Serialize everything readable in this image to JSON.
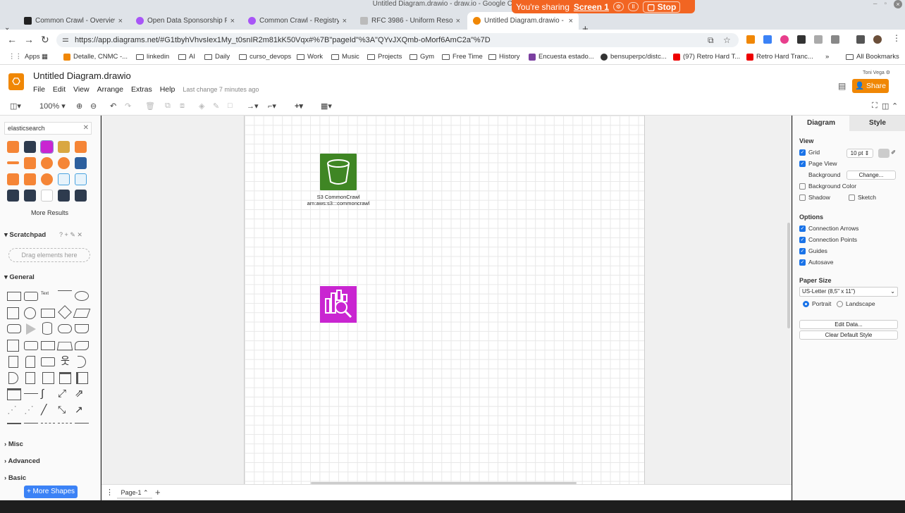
{
  "window": {
    "title": "Untitled Diagram.drawio - draw.io - Google Chrome"
  },
  "share_banner": {
    "text": "You're sharing",
    "screen": "Screen 1",
    "stop": "Stop"
  },
  "tabs": [
    {
      "label": "Common Crawl - Overview",
      "color": "#222222"
    },
    {
      "label": "Open Data Sponsorship Prog...",
      "color": "#a855f7"
    },
    {
      "label": "Common Crawl - Registry of...",
      "color": "#a855f7"
    },
    {
      "label": "RFC 3986 - Uniform Resourc...",
      "color": "#bbbbbb"
    },
    {
      "label": "Untitled Diagram.drawio - d...",
      "color": "#f08705"
    }
  ],
  "address": {
    "url": "https://app.diagrams.net/#G1tbyhVhvsIex1My_t0snIR2m81kK50Vqx#%7B\"pageId\"%3A\"QYvJXQmb-oMorf6AmC2a\"%7D"
  },
  "bookmarks": [
    "Apps",
    "Detalle, CNMC -...",
    "linkedin",
    "AI",
    "Daily",
    "curso_devops",
    "Work",
    "Music",
    "Projects",
    "Gym",
    "Free Time",
    "History",
    "Encuesta estado...",
    "bensuperpc/distc...",
    "(97) Retro Hard T...",
    "Retro Hard Tranc...",
    "All Bookmarks"
  ],
  "drawio": {
    "title": "Untitled Diagram.drawio",
    "menu": [
      "File",
      "Edit",
      "View",
      "Arrange",
      "Extras",
      "Help"
    ],
    "last_change": "Last change 7 minutes ago",
    "user": "Toni Vega",
    "share": "Share",
    "zoom": "100%"
  },
  "left": {
    "search_value": "elasticsearch",
    "more_results": "More Results",
    "scratchpad": "Scratchpad",
    "drag_here": "Drag elements here",
    "general": "General",
    "misc": "Misc",
    "advanced": "Advanced",
    "basic": "Basic",
    "more_shapes": "+ More Shapes"
  },
  "canvas": {
    "s3_name": "S3 CommonCrawl",
    "s3_arn": "arn:aws:s3:::commoncrawl",
    "page_tab": "Page-1"
  },
  "right": {
    "tab_diagram": "Diagram",
    "tab_style": "Style",
    "view": "View",
    "grid": "Grid",
    "grid_size": "10 pt",
    "page_view": "Page View",
    "background": "Background",
    "change": "Change...",
    "background_color": "Background Color",
    "shadow": "Shadow",
    "sketch": "Sketch",
    "options": "Options",
    "connection_arrows": "Connection Arrows",
    "connection_points": "Connection Points",
    "guides": "Guides",
    "autosave": "Autosave",
    "paper_size": "Paper Size",
    "paper_value": "US-Letter (8,5\" x 11\")",
    "portrait": "Portrait",
    "landscape": "Landscape",
    "edit_data": "Edit Data...",
    "clear_default": "Clear Default Style"
  },
  "colors": {
    "accent": "#f08705",
    "s3": "#3f8624",
    "analytics": "#c925d1",
    "banner": "#f26522"
  }
}
